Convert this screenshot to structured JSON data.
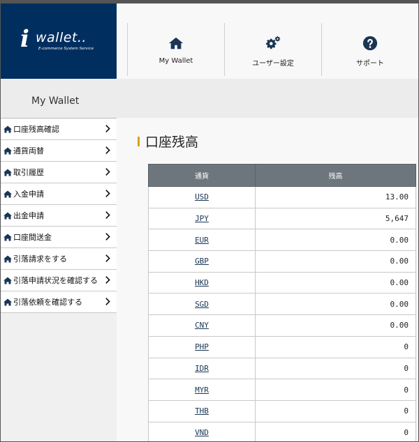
{
  "logo": {
    "word": "wallet..",
    "letter": "i",
    "tagline": "E-commerce System Service"
  },
  "topnav": [
    {
      "label": "My Wallet",
      "icon": "home-icon"
    },
    {
      "label": "ユーザー設定",
      "icon": "gears-icon"
    },
    {
      "label": "サポート",
      "icon": "question-circle-icon"
    }
  ],
  "sidebar": {
    "title": "My Wallet",
    "items": [
      {
        "label": "口座残高確認"
      },
      {
        "label": "通貨両替"
      },
      {
        "label": "取引履歴"
      },
      {
        "label": "入金申請"
      },
      {
        "label": "出金申請"
      },
      {
        "label": "口座間送金"
      },
      {
        "label": "引落請求をする"
      },
      {
        "label": "引落申請状況を確認する"
      },
      {
        "label": "引落依頼を確認する"
      }
    ]
  },
  "main": {
    "heading": "口座残高",
    "table": {
      "headers": {
        "currency": "通貨",
        "balance": "残高"
      },
      "rows": [
        {
          "currency": "USD",
          "balance": "13.00"
        },
        {
          "currency": "JPY",
          "balance": "5,647"
        },
        {
          "currency": "EUR",
          "balance": "0.00"
        },
        {
          "currency": "GBP",
          "balance": "0.00"
        },
        {
          "currency": "HKD",
          "balance": "0.00"
        },
        {
          "currency": "SGD",
          "balance": "0.00"
        },
        {
          "currency": "CNY",
          "balance": "0.00"
        },
        {
          "currency": "PHP",
          "balance": "0"
        },
        {
          "currency": "IDR",
          "balance": "0"
        },
        {
          "currency": "MYR",
          "balance": "0"
        },
        {
          "currency": "THB",
          "balance": "0"
        },
        {
          "currency": "VND",
          "balance": "0"
        }
      ]
    }
  },
  "colors": {
    "brand": "#002f5f",
    "accent": "#d9a300",
    "table_header": "#6e767d",
    "link": "#1a3555"
  }
}
